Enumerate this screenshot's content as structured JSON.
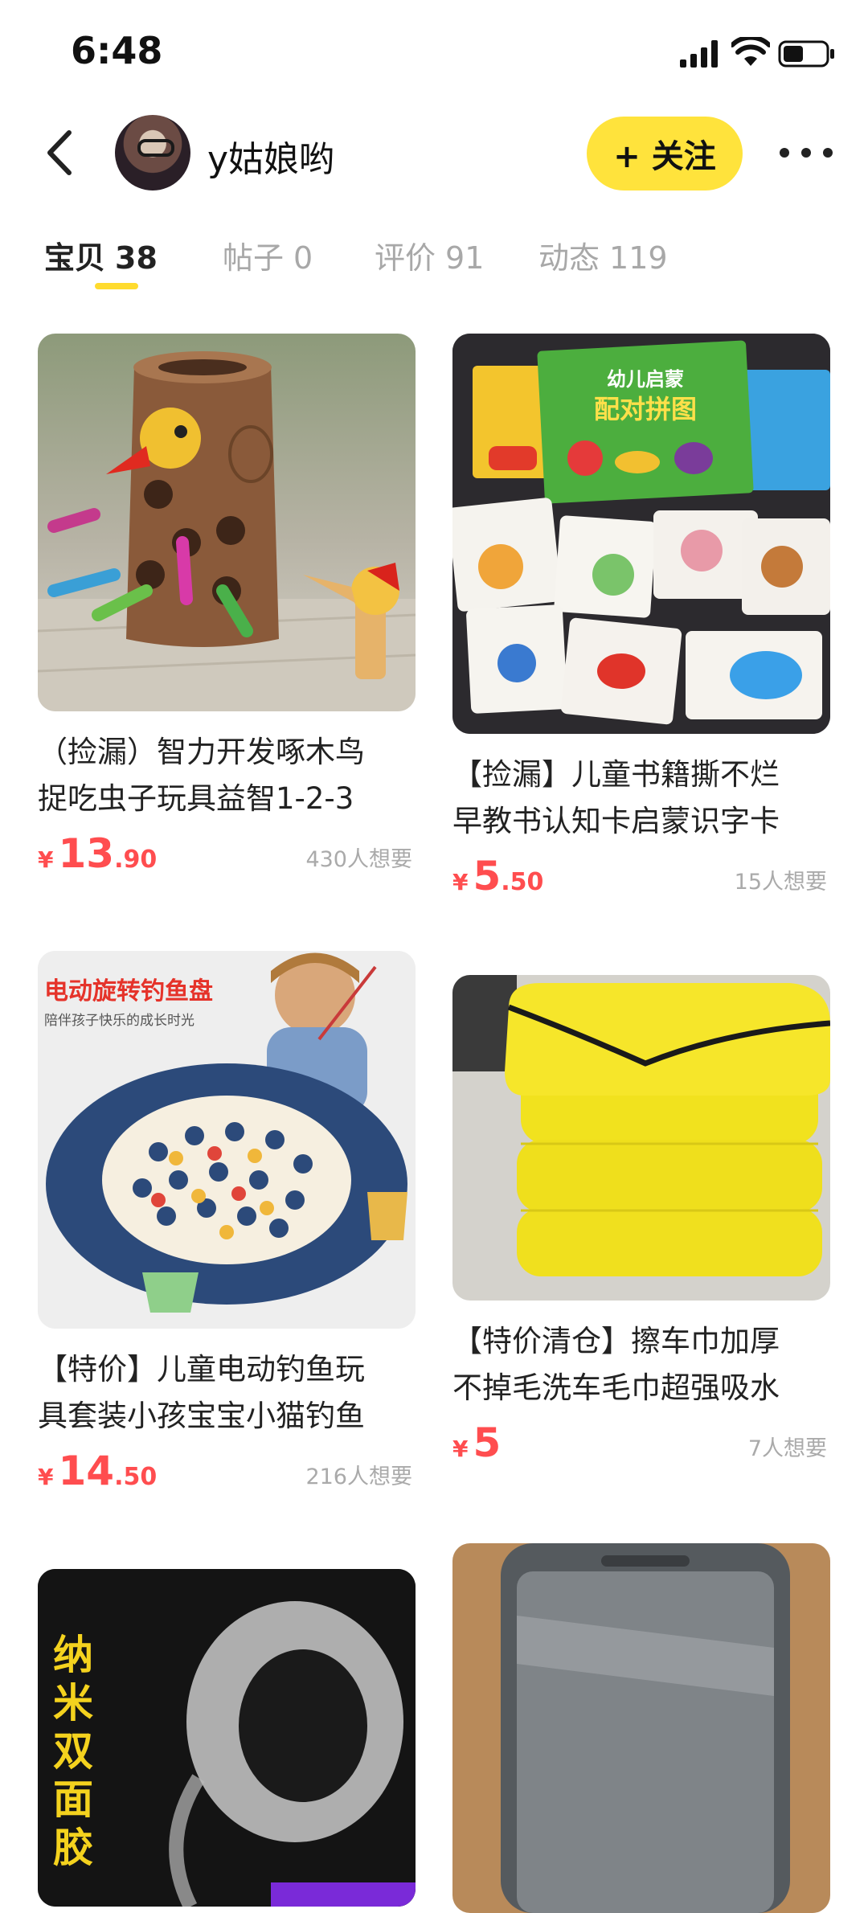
{
  "status_bar": {
    "time": "6:48"
  },
  "header": {
    "username": "y姑娘哟",
    "follow_label": "+ 关注"
  },
  "tabs": [
    {
      "label": "宝贝",
      "count": "38",
      "active": true
    },
    {
      "label": "帖子",
      "count": "0",
      "active": false
    },
    {
      "label": "评价",
      "count": "91",
      "active": false
    },
    {
      "label": "动态",
      "count": "119",
      "active": false
    }
  ],
  "products": [
    {
      "title_line1": "（捡漏）智力开发啄木鸟",
      "title_line2": "捉吃虫子玩具益智1-2-3",
      "price_symbol": "¥",
      "price_int": "13",
      "price_dec": ".90",
      "wants": "430人想要"
    },
    {
      "title_line1": "【捡漏】儿童书籍撕不烂",
      "title_line2": "早教书认知卡启蒙识字卡",
      "price_symbol": "¥",
      "price_int": "5",
      "price_dec": ".50",
      "wants": "15人想要",
      "image_text": {
        "box_label": "幼儿启蒙",
        "box_title": "配对拼图"
      }
    },
    {
      "title_line1": "【特价】儿童电动钓鱼玩",
      "title_line2": "具套装小孩宝宝小猫钓鱼",
      "price_symbol": "¥",
      "price_int": "14",
      "price_dec": ".50",
      "wants": "216人想要",
      "image_text": {
        "banner": "电动旋转钓鱼盘",
        "sub": "陪伴孩子快乐的成长时光"
      }
    },
    {
      "title_line1": "【特价清仓】擦车巾加厚",
      "title_line2": "不掉毛洗车毛巾超强吸水",
      "price_symbol": "¥",
      "price_int": "5",
      "price_dec": "",
      "wants": "7人想要"
    },
    {
      "image_text": {
        "vertical": "纳米双面胶"
      }
    },
    {
      "image_text": {}
    }
  ],
  "colors": {
    "accent_yellow": "#ffe33c",
    "price_red": "#ff4d4f",
    "muted_gray": "#aaaaaa"
  }
}
